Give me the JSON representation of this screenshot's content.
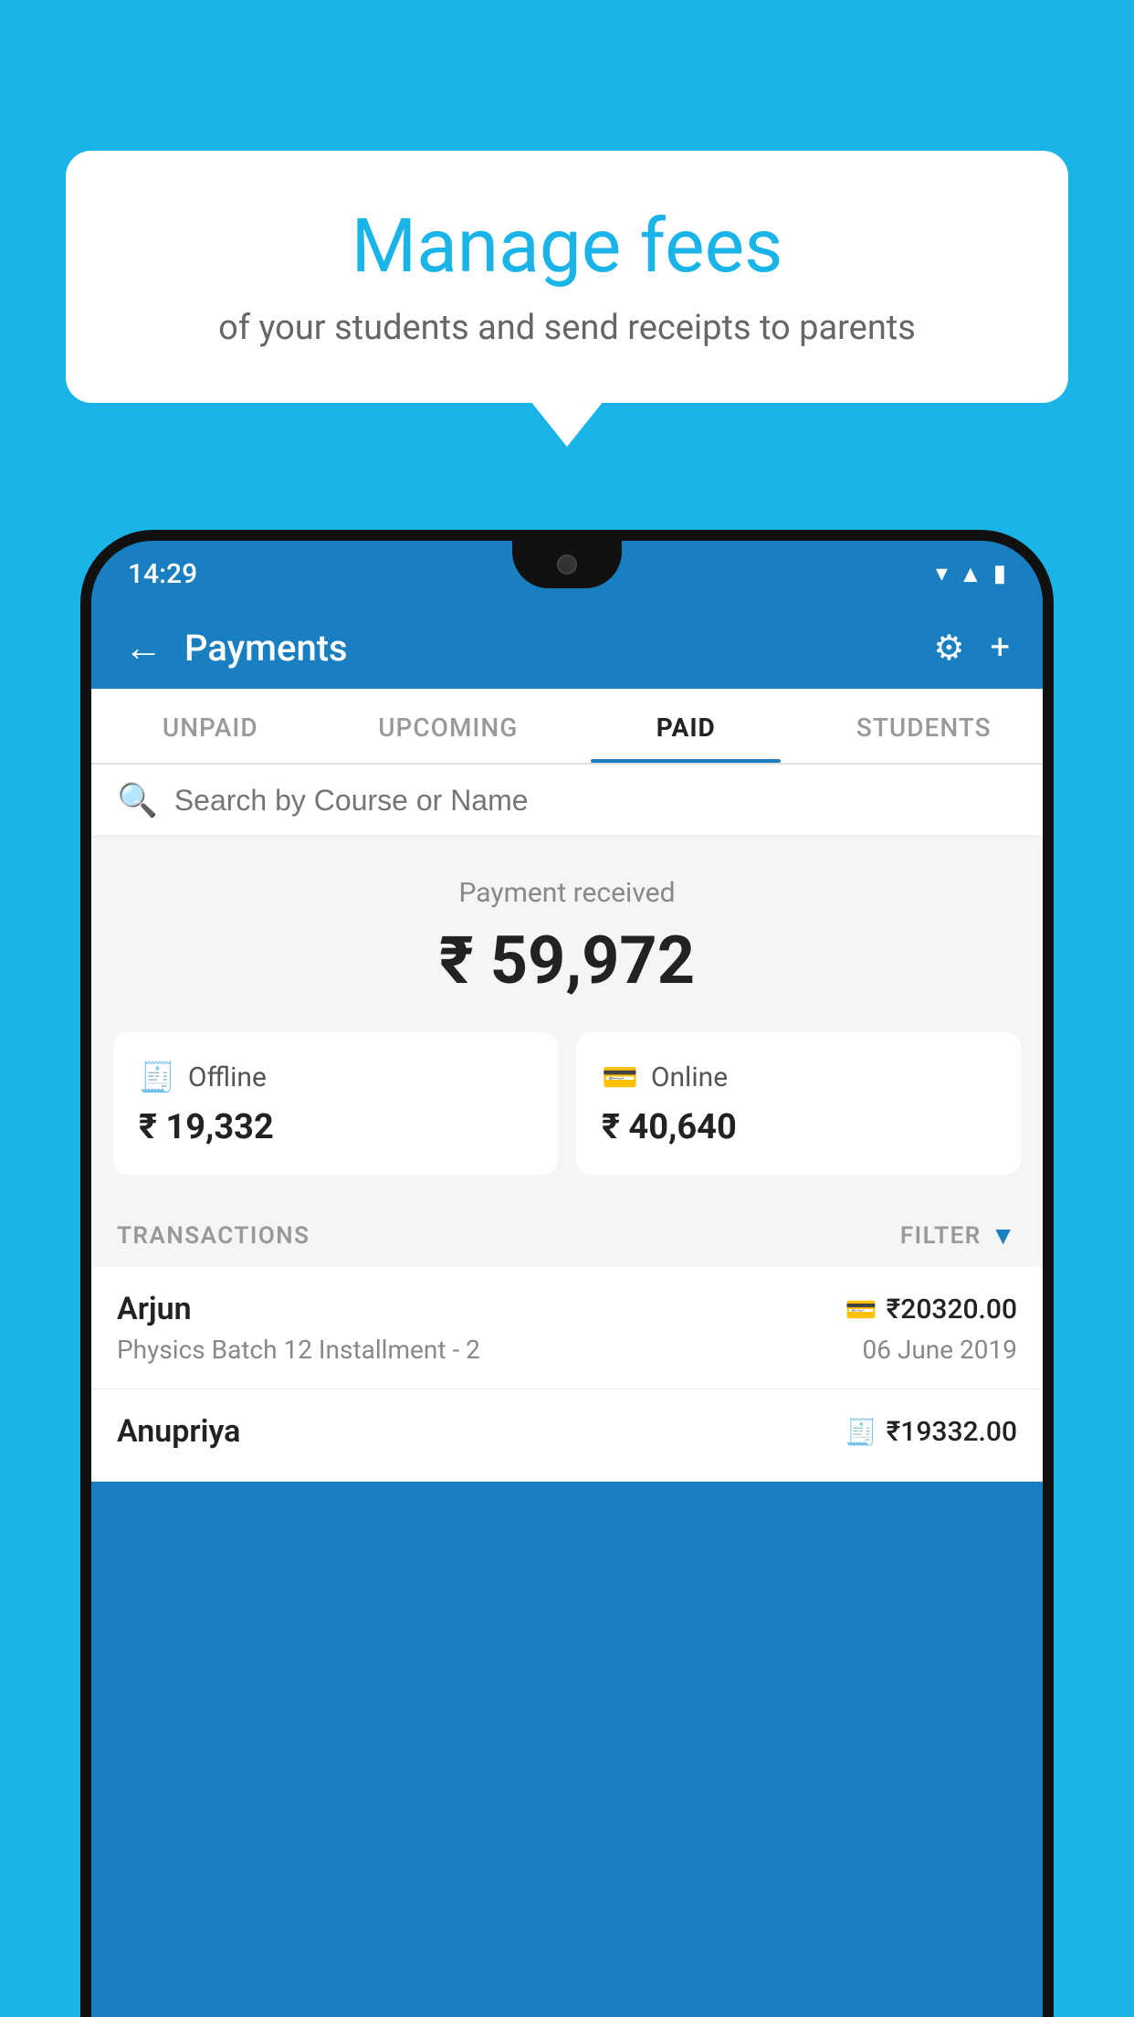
{
  "background_color": "#1ab4e8",
  "bubble": {
    "title": "Manage fees",
    "subtitle": "of your students and send receipts to parents"
  },
  "phone": {
    "status_bar": {
      "time": "14:29",
      "icons": [
        "▼",
        "▲",
        "▮"
      ]
    },
    "header": {
      "title": "Payments",
      "back_label": "←",
      "settings_icon": "⚙",
      "add_icon": "+"
    },
    "tabs": [
      {
        "label": "UNPAID",
        "active": false
      },
      {
        "label": "UPCOMING",
        "active": false
      },
      {
        "label": "PAID",
        "active": true
      },
      {
        "label": "STUDENTS",
        "active": false
      }
    ],
    "search": {
      "placeholder": "Search by Course or Name"
    },
    "payment_summary": {
      "label": "Payment received",
      "amount": "₹ 59,972",
      "offline": {
        "label": "Offline",
        "amount": "₹ 19,332"
      },
      "online": {
        "label": "Online",
        "amount": "₹ 40,640"
      }
    },
    "transactions": {
      "header_label": "TRANSACTIONS",
      "filter_label": "FILTER",
      "rows": [
        {
          "name": "Arjun",
          "course": "Physics Batch 12 Installment - 2",
          "amount": "₹20320.00",
          "date": "06 June 2019",
          "mode_icon": "card"
        },
        {
          "name": "Anupriya",
          "course": "",
          "amount": "₹19332.00",
          "date": "",
          "mode_icon": "cash"
        }
      ]
    }
  }
}
